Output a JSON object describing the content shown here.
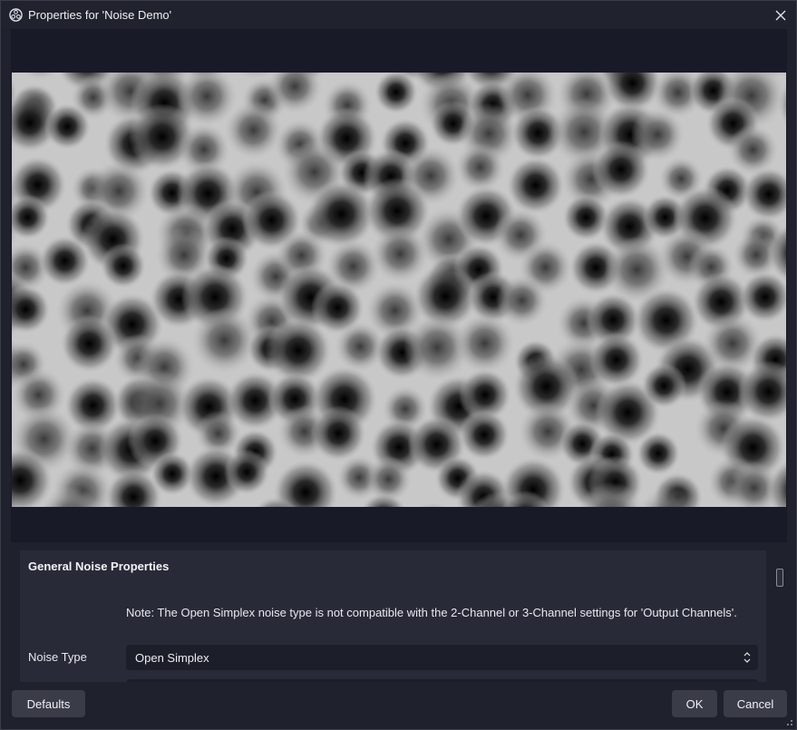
{
  "window": {
    "title": "Properties for 'Noise Demo'",
    "app_icon": "obs-logo-icon",
    "close_icon": "close-icon"
  },
  "preview": {
    "content": "cellular-noise-preview",
    "colors": {
      "background_frame": "#181a28",
      "noise_dark": "#000000",
      "noise_light": "#ffffff"
    }
  },
  "properties": {
    "group_title": "General Noise Properties",
    "note": "Note: The Open Simplex noise type is not compatible with the 2-Channel or 3-Channel settings for 'Output Channels'.",
    "noise_type": {
      "label": "Noise Type",
      "value": "Open Simplex",
      "icon": "updown-arrows-icon"
    }
  },
  "footer": {
    "defaults_label": "Defaults",
    "ok_label": "OK",
    "cancel_label": "Cancel"
  },
  "theme": {
    "window_bg": "#1f212d",
    "panel_bg": "#282a37",
    "input_bg": "#1c1e2a",
    "button_bg": "#3a3c48",
    "text": "#e8e8ee"
  }
}
